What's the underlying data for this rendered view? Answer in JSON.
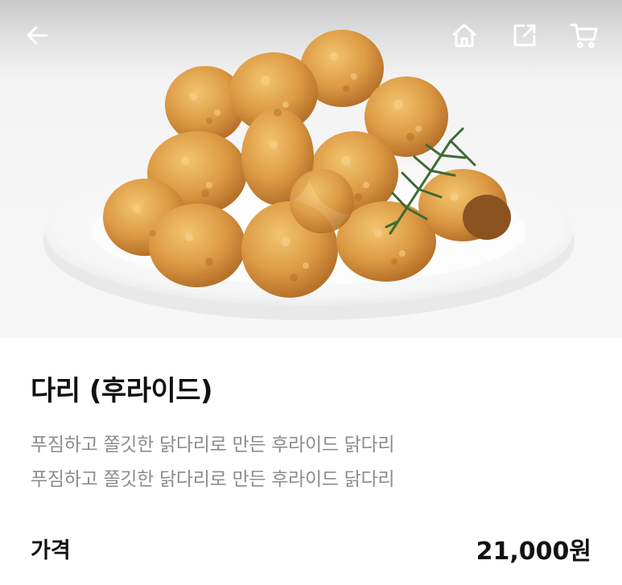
{
  "header": {
    "back_icon": "arrow-left-icon",
    "home_icon": "home-icon",
    "share_icon": "share-icon",
    "cart_icon": "cart-icon"
  },
  "product": {
    "image": "fried-chicken-drumsticks-photo",
    "name": "다리 (후라이드)",
    "description_lines": [
      "푸짐하고 쫄깃한 닭다리로 만든 후라이드 닭다리",
      "푸짐하고 쫄깃한 닭다리로 만든 후라이드 닭다리"
    ],
    "price_label": "가격",
    "price": "21,000원"
  },
  "colors": {
    "title": "#111111",
    "description": "#8c8c8c",
    "chicken": "#d9963e"
  }
}
